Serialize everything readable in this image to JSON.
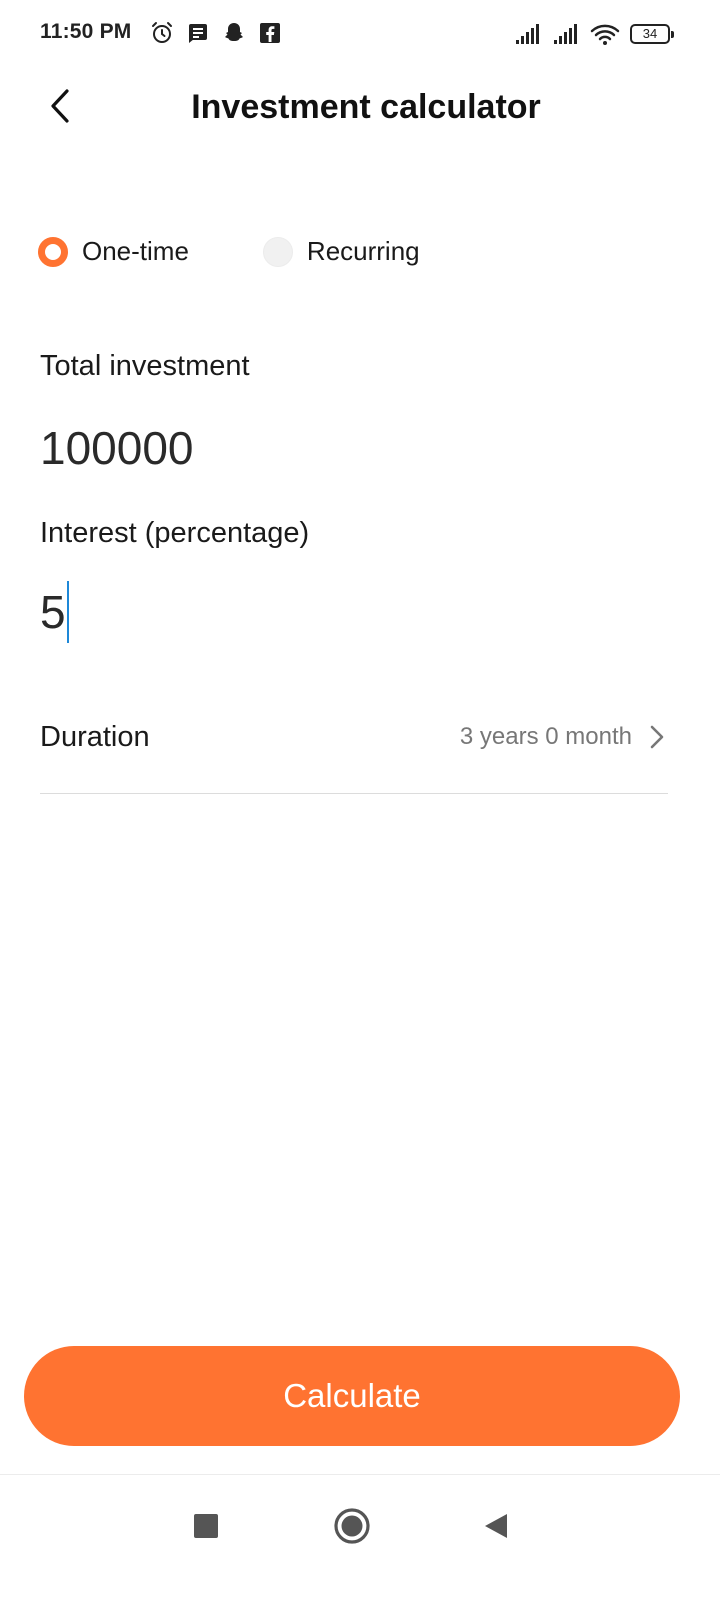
{
  "status_bar": {
    "time": "11:50 PM",
    "left_icons": [
      "alarm-icon",
      "message-icon",
      "snapchat-icon",
      "facebook-icon"
    ],
    "right_icons": [
      "signal-icon",
      "signal-icon",
      "wifi-icon",
      "battery-icon"
    ],
    "battery_level": "34"
  },
  "header": {
    "title": "Investment calculator",
    "back_icon": "chevron-left-icon"
  },
  "investment_type": {
    "options": [
      {
        "label": "One-time",
        "selected": true
      },
      {
        "label": "Recurring",
        "selected": false
      }
    ]
  },
  "form": {
    "total_investment_label": "Total investment",
    "total_investment_value": "100000",
    "interest_label": "Interest (percentage)",
    "interest_value": "5",
    "duration_label": "Duration",
    "duration_value": "3 years 0 month"
  },
  "actions": {
    "calculate_label": "Calculate"
  },
  "nav_bar": {
    "buttons": [
      "recents-square-icon",
      "home-circle-icon",
      "back-triangle-icon"
    ]
  },
  "colors": {
    "accent": "#ff7331",
    "caret": "#1e88d8",
    "secondary_text": "#777777"
  }
}
